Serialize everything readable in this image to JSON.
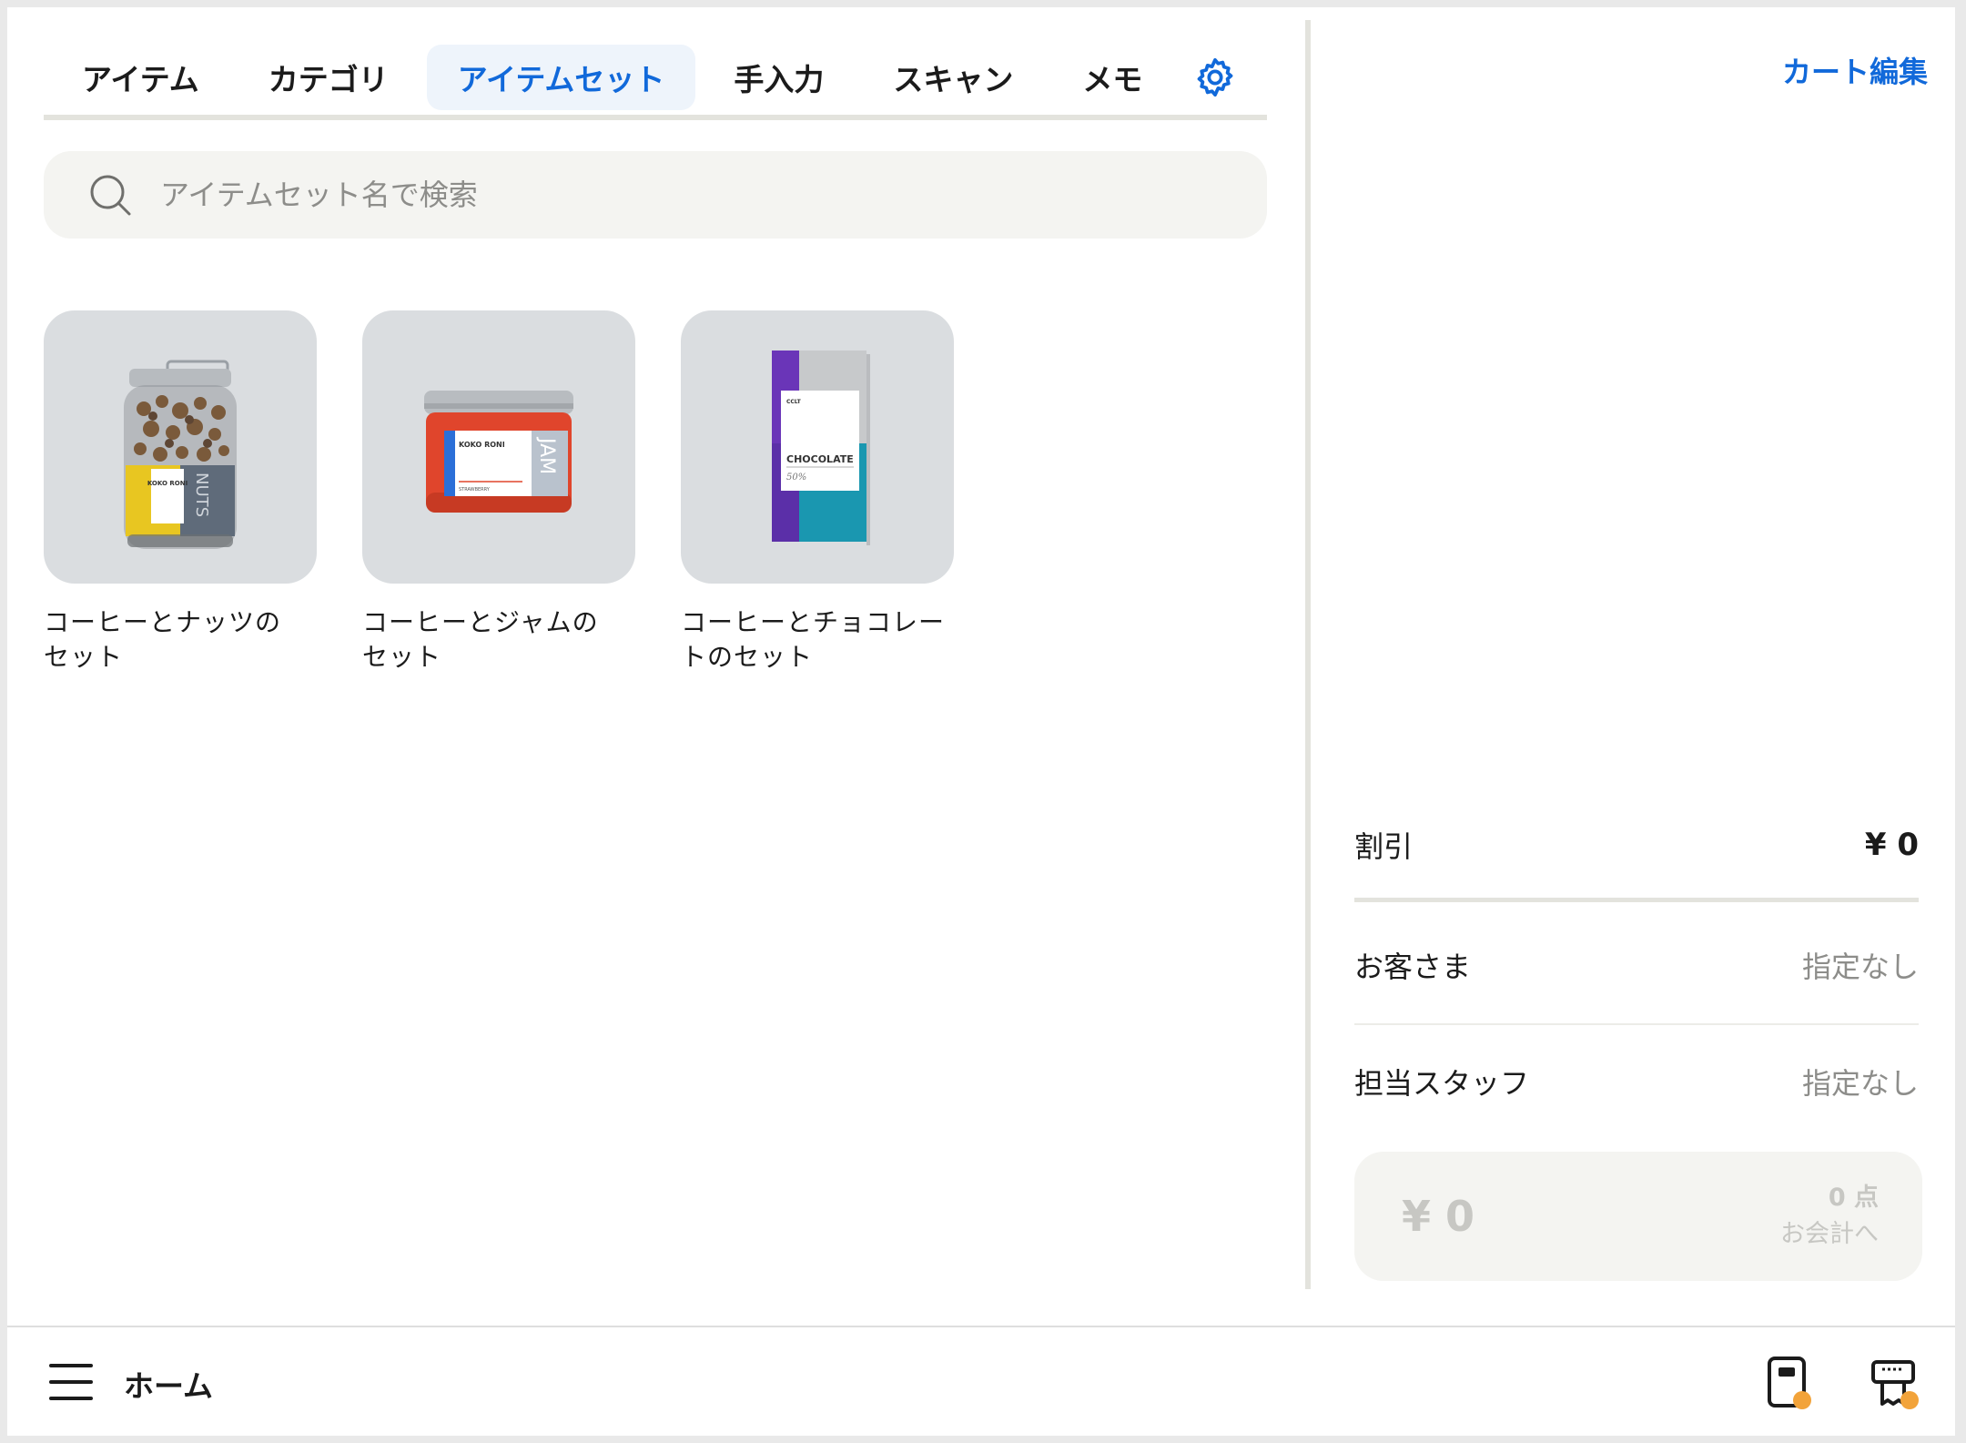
{
  "tabs": [
    {
      "label": "アイテム"
    },
    {
      "label": "カテゴリ"
    },
    {
      "label": "アイテムセット",
      "active": true
    },
    {
      "label": "手入力"
    },
    {
      "label": "スキャン"
    },
    {
      "label": "メモ"
    }
  ],
  "search": {
    "placeholder": "アイテムセット名で検索"
  },
  "item_sets": [
    {
      "line1": "コーヒーとナッツの",
      "line2": "セット",
      "image": "nuts-jar"
    },
    {
      "line1": "コーヒーとジャムの",
      "line2": "セット",
      "image": "jam-jar"
    },
    {
      "line1": "コーヒーとチョコレー",
      "line2": "トのセット",
      "image": "chocolate-bar"
    }
  ],
  "product_labels": {
    "nuts_brand": "KOKO RONI",
    "nuts_name": "NUTS",
    "jam_brand": "KOKO RONI",
    "jam_flavor": "STRAWBERRY",
    "jam_name": "JAM",
    "choc_brand": "CCLT",
    "choc_name": "CHOCOLATE",
    "choc_percent": "50%"
  },
  "cart": {
    "edit_label": "カート編集",
    "discount_label": "割引",
    "discount_value": "¥ 0",
    "customer_label": "お客さま",
    "customer_value": "指定なし",
    "staff_label": "担当スタッフ",
    "staff_value": "指定なし",
    "total": "¥ 0",
    "count": "0 点",
    "checkout_label": "お会計へ"
  },
  "bottom": {
    "home_label": "ホーム"
  },
  "icons": {
    "settings": "gear-icon",
    "search": "search-icon",
    "menu": "hamburger-menu-icon",
    "reader": "card-reader-icon",
    "printer": "receipt-printer-icon"
  },
  "colors": {
    "accent": "#1169da",
    "status_dot": "#f2a33a",
    "tab_active_bg": "#eef4fb"
  }
}
